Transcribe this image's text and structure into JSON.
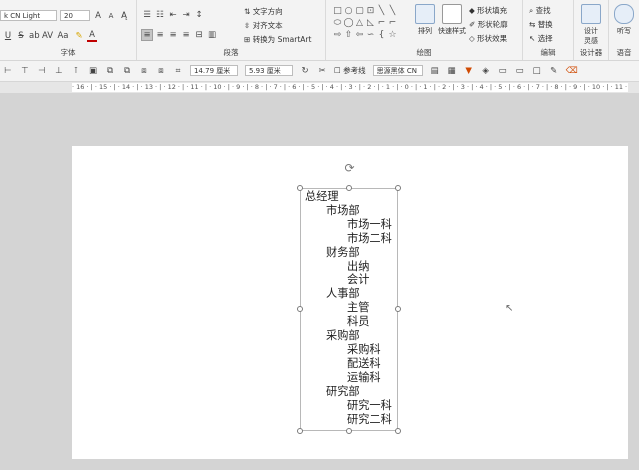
{
  "font": {
    "name": "k CN Light",
    "size": "20"
  },
  "groups": {
    "font": "字体",
    "paragraph": "段落",
    "drawing": "绘图",
    "editing": "编辑",
    "designer": "设计器",
    "voice": "语音"
  },
  "paragraph": {
    "text_direction": "文字方向",
    "align_text": "对齐文本",
    "convert_smartart": "转换为 SmartArt"
  },
  "drawing": {
    "arrange": "排列",
    "quick_styles": "快速样式",
    "shape_fill": "形状填充",
    "shape_outline": "形状轮廓",
    "shape_effects": "形状效果"
  },
  "editing": {
    "find": "查找",
    "replace": "替换",
    "select": "选择"
  },
  "designer": {
    "label": "设计\n灵感"
  },
  "voice": {
    "label": "听写"
  },
  "toolbar2": {
    "width": "14.79 厘米",
    "height": "5.93 厘米",
    "guides": "参考线",
    "font2": "思源黑体 CN"
  },
  "ruler": {
    "text": "· 16 · | · 15 · | · 14 · | · 13 · | · 12 · | · 11 · | · 10 · | · 9 · | · 8 · | · 7 · | · 6 · | · 5 · | · 4 · | · 3 · | · 2 · | · 1 · | · 0 · | · 1 · | · 2 · | · 3 · | · 4 · | · 5 · | · 6 · | · 7 · | · 8 · | · 9 · | · 10 · | · 11 · | · 12 · | · 13 · | · 14 · | · 15 · | · 16 ·"
  },
  "tree": [
    {
      "text": "总经理",
      "level": 0
    },
    {
      "text": "市场部",
      "level": 1
    },
    {
      "text": "市场一科",
      "level": 2
    },
    {
      "text": "市场二科",
      "level": 2
    },
    {
      "text": "财务部",
      "level": 1
    },
    {
      "text": "出纳",
      "level": 2
    },
    {
      "text": "会计",
      "level": 2
    },
    {
      "text": "人事部",
      "level": 1
    },
    {
      "text": "主管",
      "level": 2
    },
    {
      "text": "科员",
      "level": 2
    },
    {
      "text": "采购部",
      "level": 1
    },
    {
      "text": "采购科",
      "level": 2
    },
    {
      "text": "配送科",
      "level": 2
    },
    {
      "text": "运输科",
      "level": 2
    },
    {
      "text": "研究部",
      "level": 1
    },
    {
      "text": "研究一科",
      "level": 2
    },
    {
      "text": "研究二科",
      "level": 2
    }
  ]
}
